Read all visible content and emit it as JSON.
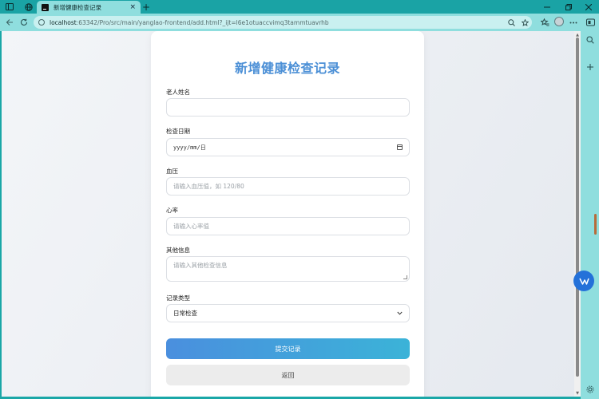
{
  "browser": {
    "tab": {
      "title": "新增健康检查记录",
      "close_glyph": "×"
    },
    "new_tab_glyph": "+",
    "address": {
      "host": "localhost",
      "rest": ":63342/Pro/src/main/yanglao-frontend/add.html?_ijt=l6e1otuaccvimq3tammtuavrhb"
    }
  },
  "form": {
    "title": "新增健康检查记录",
    "fields": {
      "name": {
        "label": "老人姓名",
        "value": ""
      },
      "date": {
        "label": "检查日期",
        "placeholder": "yyyy/mm/日"
      },
      "bp": {
        "label": "血压",
        "placeholder": "请输入血压值，如 120/80"
      },
      "hr": {
        "label": "心率",
        "placeholder": "请输入心率值"
      },
      "other": {
        "label": "其他信息",
        "placeholder": "请输入其他检查信息"
      },
      "type": {
        "label": "记录类型",
        "selected": "日常检查"
      }
    },
    "submit_label": "提交记录",
    "back_label": "返回"
  },
  "colors": {
    "accent": "#4b8fd6",
    "button_gradient_start": "#4a8fde",
    "button_gradient_end": "#3bb3d8",
    "browser_frame": "#1aa3a5"
  },
  "icons": {
    "sidebar-toggle": "sidebar-icon",
    "workspaces": "workspaces-icon",
    "back": "back-arrow-icon",
    "refresh": "refresh-icon",
    "zoom": "zoom-icon",
    "favorites": "star-icon",
    "profile": "avatar",
    "more": "more-icon",
    "copilot": "copilot-icon",
    "search": "search-icon",
    "add": "plus-icon",
    "settings": "gear-icon"
  }
}
